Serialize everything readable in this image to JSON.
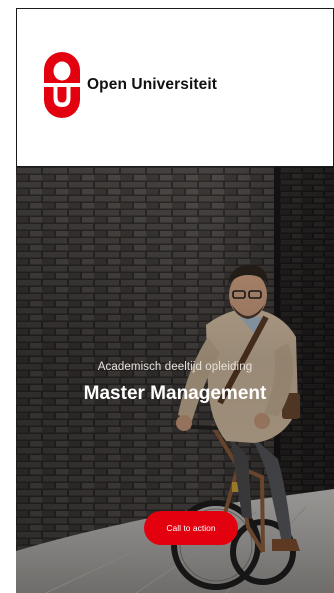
{
  "brand": {
    "name": "Open Universiteit",
    "logo_icon": "ou-logo-icon",
    "logo_color": "#e3000f"
  },
  "hero": {
    "subtitle": "Academisch deeltijd opleiding",
    "title": "Master Management",
    "cta_label": "Call to action",
    "cta_color": "#e3000f",
    "image_subject": "man-riding-bicycle-photo"
  }
}
